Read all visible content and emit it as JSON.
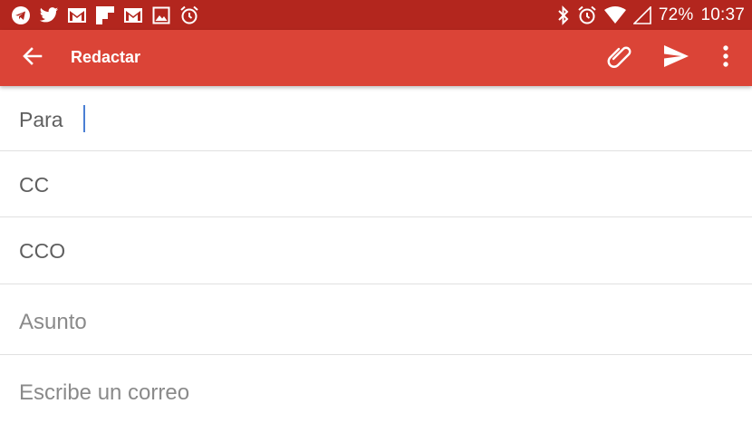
{
  "status_bar": {
    "left_icons": [
      "telegram-icon",
      "twitter-icon",
      "gmail-icon",
      "flipboard-icon",
      "gmail-icon",
      "image-icon",
      "alarm-icon"
    ],
    "right_icons": [
      "bluetooth-icon",
      "alarm-icon",
      "wifi-icon",
      "cell-signal-icon"
    ],
    "battery": "72%",
    "time": "10:37"
  },
  "app_bar": {
    "title": "Redactar",
    "back_icon": "arrow-back-icon",
    "actions": [
      "attach-icon",
      "send-icon",
      "more-vert-icon"
    ]
  },
  "form": {
    "to_label": "Para",
    "to_value": "",
    "cc_label": "CC",
    "bcc_label": "CCO",
    "subject_placeholder": "Asunto",
    "body_placeholder": "Escribe un correo"
  },
  "colors": {
    "status_bar": "#b3261e",
    "app_bar": "#db4437",
    "cursor": "#4a7fd4"
  }
}
